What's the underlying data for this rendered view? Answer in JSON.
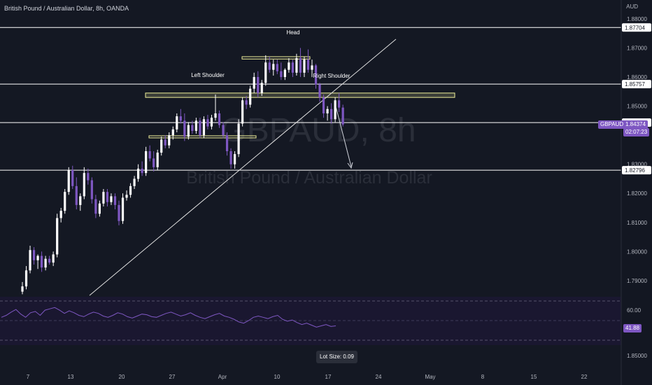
{
  "header": {
    "title": "British Pound / Australian Dollar, 8h, OANDA",
    "currency": "AUD"
  },
  "watermark": {
    "symbol": "GBPAUD, 8h",
    "name": "British Pound / Australian Dollar"
  },
  "annotations": {
    "head": "Head",
    "left_shoulder": "Left Shoulder",
    "right_shoulder": "Right Shoulder"
  },
  "price_tag": {
    "symbol": "GBPAUD",
    "price": "1.84374",
    "countdown": "02:07:23"
  },
  "rsi_tag": "41.88",
  "lot_size": "Lot Size: 0.09",
  "colors": {
    "bull": "#ffffff",
    "bear": "#7e57c2",
    "bg": "#131722",
    "zone": "#f0f09a",
    "rsi": "#7e57c2"
  },
  "chart_data": {
    "type": "candlestick",
    "symbol": "GBPAUD",
    "interval": "8h",
    "ylim": [
      1.7825,
      1.8812
    ],
    "y_ticks": [
      "1.88000",
      "1.87000",
      "1.86000",
      "1.85000",
      "1.83000",
      "1.82000",
      "1.81000",
      "1.80000",
      "1.79000"
    ],
    "x_ticks": [
      "7",
      "13",
      "20",
      "27",
      "Apr",
      "10",
      "17",
      "24",
      "May",
      "8",
      "15",
      "22"
    ],
    "levels": [
      {
        "price": 1.87704,
        "label": "1.87704"
      },
      {
        "price": 1.85757,
        "label": "1.85757"
      },
      {
        "price": 1.84433,
        "label": "1.84433"
      },
      {
        "price": 1.82796,
        "label": "1.82796"
      }
    ],
    "zones": [
      {
        "from": 1.853,
        "to": 1.8545
      },
      {
        "from": 1.8392,
        "to": 1.8398
      },
      {
        "from": 1.8662,
        "to": 1.867
      }
    ],
    "rsi": {
      "ticks": [
        "60.00"
      ],
      "lower_label": "1.85000",
      "last": 41.88
    },
    "candles": [
      [
        1.7862,
        1.7895,
        1.7853,
        1.788
      ],
      [
        1.788,
        1.795,
        1.787,
        1.7935
      ],
      [
        1.7935,
        1.802,
        1.7925,
        1.8005
      ],
      [
        1.8005,
        1.8015,
        1.7955,
        1.797
      ],
      [
        1.797,
        1.799,
        1.794,
        1.7985
      ],
      [
        1.7985,
        1.8,
        1.793,
        1.7945
      ],
      [
        1.7945,
        1.7985,
        1.7935,
        1.7975
      ],
      [
        1.7975,
        1.7985,
        1.7955,
        1.7962
      ],
      [
        1.7962,
        1.8,
        1.795,
        1.799
      ],
      [
        1.799,
        1.813,
        1.798,
        1.8115
      ],
      [
        1.8115,
        1.815,
        1.81,
        1.814
      ],
      [
        1.814,
        1.8215,
        1.813,
        1.8205
      ],
      [
        1.8205,
        1.829,
        1.8195,
        1.828
      ],
      [
        1.828,
        1.8295,
        1.8215,
        1.8225
      ],
      [
        1.8225,
        1.8255,
        1.8145,
        1.816
      ],
      [
        1.816,
        1.82,
        1.814,
        1.819
      ],
      [
        1.819,
        1.829,
        1.818,
        1.827
      ],
      [
        1.827,
        1.8285,
        1.823,
        1.8245
      ],
      [
        1.8245,
        1.8255,
        1.8165,
        1.818
      ],
      [
        1.818,
        1.8195,
        1.8115,
        1.813
      ],
      [
        1.813,
        1.8175,
        1.812,
        1.8165
      ],
      [
        1.8165,
        1.8215,
        1.8155,
        1.8205
      ],
      [
        1.8205,
        1.8215,
        1.8155,
        1.817
      ],
      [
        1.817,
        1.82,
        1.816,
        1.819
      ],
      [
        1.819,
        1.82,
        1.8145,
        1.816
      ],
      [
        1.816,
        1.8175,
        1.809,
        1.8105
      ],
      [
        1.8105,
        1.82,
        1.8095,
        1.8185
      ],
      [
        1.8185,
        1.821,
        1.8175,
        1.8195
      ],
      [
        1.8195,
        1.8235,
        1.8185,
        1.8225
      ],
      [
        1.8225,
        1.826,
        1.8215,
        1.825
      ],
      [
        1.825,
        1.83,
        1.824,
        1.8285
      ],
      [
        1.8285,
        1.831,
        1.826,
        1.827
      ],
      [
        1.827,
        1.836,
        1.826,
        1.8345
      ],
      [
        1.8345,
        1.8365,
        1.831,
        1.832
      ],
      [
        1.832,
        1.8345,
        1.8275,
        1.829
      ],
      [
        1.829,
        1.835,
        1.828,
        1.834
      ],
      [
        1.834,
        1.8395,
        1.833,
        1.8385
      ],
      [
        1.8385,
        1.84,
        1.8355,
        1.8365
      ],
      [
        1.8365,
        1.841,
        1.8355,
        1.84
      ],
      [
        1.84,
        1.843,
        1.8385,
        1.842
      ],
      [
        1.842,
        1.8475,
        1.841,
        1.8465
      ],
      [
        1.8465,
        1.849,
        1.844,
        1.845
      ],
      [
        1.845,
        1.8475,
        1.838,
        1.8395
      ],
      [
        1.8395,
        1.8445,
        1.8385,
        1.8435
      ],
      [
        1.8435,
        1.845,
        1.8405,
        1.8415
      ],
      [
        1.8415,
        1.846,
        1.8405,
        1.845
      ],
      [
        1.845,
        1.846,
        1.839,
        1.84
      ],
      [
        1.84,
        1.8465,
        1.839,
        1.8455
      ],
      [
        1.8455,
        1.847,
        1.842,
        1.843
      ],
      [
        1.843,
        1.847,
        1.842,
        1.846
      ],
      [
        1.846,
        1.854,
        1.845,
        1.8475
      ],
      [
        1.8475,
        1.8485,
        1.8425,
        1.8435
      ],
      [
        1.8435,
        1.8445,
        1.839,
        1.84
      ],
      [
        1.84,
        1.841,
        1.833,
        1.8345
      ],
      [
        1.8345,
        1.8355,
        1.8285,
        1.83
      ],
      [
        1.83,
        1.8345,
        1.8285,
        1.8335
      ],
      [
        1.8335,
        1.8455,
        1.8325,
        1.844
      ],
      [
        1.844,
        1.853,
        1.843,
        1.852
      ],
      [
        1.852,
        1.8535,
        1.849,
        1.8505
      ],
      [
        1.8505,
        1.857,
        1.8495,
        1.856
      ],
      [
        1.856,
        1.8615,
        1.8545,
        1.86
      ],
      [
        1.86,
        1.862,
        1.853,
        1.8545
      ],
      [
        1.8545,
        1.859,
        1.8535,
        1.858
      ],
      [
        1.858,
        1.8675,
        1.857,
        1.865
      ],
      [
        1.865,
        1.867,
        1.8615,
        1.8625
      ],
      [
        1.8625,
        1.866,
        1.8605,
        1.8645
      ],
      [
        1.8645,
        1.866,
        1.861,
        1.862
      ],
      [
        1.862,
        1.865,
        1.859,
        1.86
      ],
      [
        1.86,
        1.863,
        1.859,
        1.8625
      ],
      [
        1.8625,
        1.8665,
        1.8615,
        1.865
      ],
      [
        1.865,
        1.866,
        1.86,
        1.8615
      ],
      [
        1.8615,
        1.868,
        1.8605,
        1.8665
      ],
      [
        1.8665,
        1.87,
        1.86,
        1.8615
      ],
      [
        1.8615,
        1.867,
        1.86,
        1.866
      ],
      [
        1.866,
        1.8695,
        1.8615,
        1.8625
      ],
      [
        1.8625,
        1.866,
        1.86,
        1.864
      ],
      [
        1.864,
        1.8645,
        1.856,
        1.8575
      ],
      [
        1.8575,
        1.858,
        1.8515,
        1.853
      ],
      [
        1.853,
        1.854,
        1.846,
        1.8475
      ],
      [
        1.8475,
        1.85,
        1.845,
        1.849
      ],
      [
        1.849,
        1.851,
        1.844,
        1.8455
      ],
      [
        1.8455,
        1.853,
        1.8445,
        1.852
      ],
      [
        1.852,
        1.8545,
        1.848,
        1.8495
      ],
      [
        1.8495,
        1.8505,
        1.843,
        1.8437
      ]
    ]
  }
}
